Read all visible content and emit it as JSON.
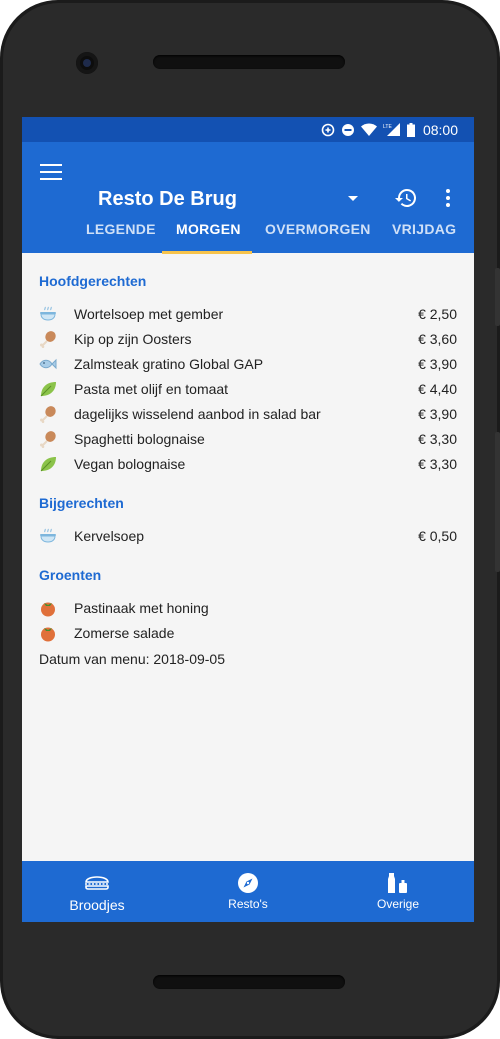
{
  "status": {
    "time": "08:00"
  },
  "app": {
    "title": "Resto De Brug",
    "accent": "#1e6ad2",
    "statusbar_color": "#1351b2",
    "indicator_color": "#f7c34b"
  },
  "tabs": [
    {
      "label": "LEGENDE"
    },
    {
      "label": "MORGEN",
      "active": true
    },
    {
      "label": "OVERMORGEN"
    },
    {
      "label": "VRIJDAG"
    }
  ],
  "sections": {
    "main": {
      "title": "Hoofdgerechten",
      "items": [
        {
          "icon": "soup-icon",
          "name": "Wortelsoep met gember",
          "price": "€ 2,50"
        },
        {
          "icon": "chicken-leg-icon",
          "name": "Kip op zijn Oosters",
          "price": "€ 3,60"
        },
        {
          "icon": "fish-icon",
          "name": "Zalmsteak gratino Global GAP",
          "price": "€ 3,90"
        },
        {
          "icon": "leaf-icon",
          "name": "Pasta met olijf en tomaat",
          "price": "€ 4,40"
        },
        {
          "icon": "chicken-leg-icon",
          "name": "dagelijks wisselend aanbod in salad bar",
          "price": "€ 3,90"
        },
        {
          "icon": "chicken-leg-icon",
          "name": "Spaghetti bolognaise",
          "price": "€ 3,30"
        },
        {
          "icon": "leaf-icon",
          "name": "Vegan bolognaise",
          "price": "€ 3,30"
        }
      ]
    },
    "side": {
      "title": "Bijgerechten",
      "items": [
        {
          "icon": "soup-icon",
          "name": "Kervelsoep",
          "price": "€ 0,50"
        }
      ]
    },
    "veg": {
      "title": "Groenten",
      "items": [
        {
          "icon": "tomato-icon",
          "name": "Pastinaak met honing"
        },
        {
          "icon": "tomato-icon",
          "name": "Zomerse salade"
        }
      ]
    }
  },
  "datum": "Datum van menu: 2018-09-05",
  "bottom_nav": [
    {
      "label": "Broodjes",
      "icon": "sandwich-icon",
      "active": true
    },
    {
      "label": "Resto's",
      "icon": "compass-icon"
    },
    {
      "label": "Overige",
      "icon": "bottles-icon"
    }
  ]
}
